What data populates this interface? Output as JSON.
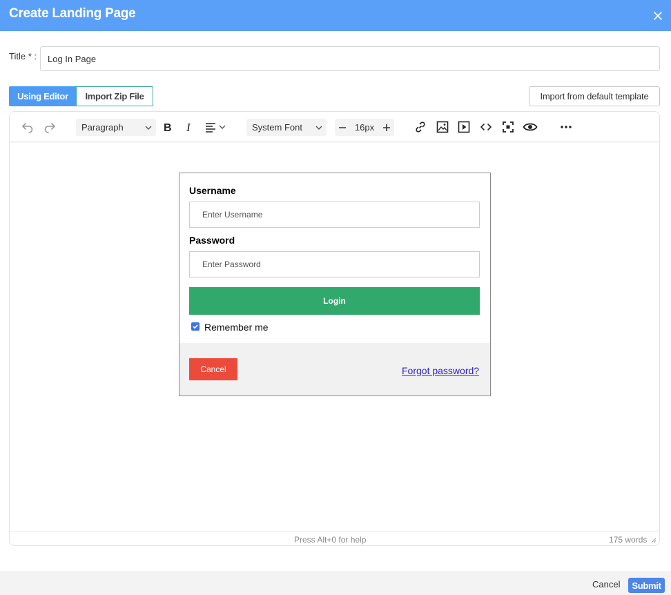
{
  "header": {
    "title": "Create Landing Page",
    "close_icon": "close-icon",
    "color": "#5aa0f8"
  },
  "form": {
    "title_label": "Title * :",
    "title_value": "Log In Page"
  },
  "tabs": [
    {
      "label": "Using Editor",
      "active": true
    },
    {
      "label": "Import Zip File",
      "active": false
    }
  ],
  "import_template_label": "Import from default template",
  "toolbar": {
    "block_format": "Paragraph",
    "font_family": "System Font",
    "font_size": "16px",
    "icons": [
      "undo-icon",
      "redo-icon",
      "bold-icon",
      "italic-icon",
      "align-left-icon",
      "link-icon",
      "image-icon",
      "media-icon",
      "code-icon",
      "fullscreen-icon",
      "preview-icon",
      "more-icon"
    ]
  },
  "preview": {
    "username_label": "Username",
    "username_placeholder": "Enter Username",
    "password_label": "Password",
    "password_placeholder": "Enter Password",
    "login_label": "Login",
    "login_color": "#31a96c",
    "remember_label": "Remember me",
    "remember_checked": true,
    "cancel_label": "Cancel",
    "cancel_color": "#ec4b3b",
    "forgot_label": "Forgot password?"
  },
  "statusbar": {
    "help": "Press Alt+0 for help",
    "words": "175 words"
  },
  "footer": {
    "cancel_label": "Cancel",
    "submit_label": "Submit",
    "submit_color": "#4d85e8"
  }
}
